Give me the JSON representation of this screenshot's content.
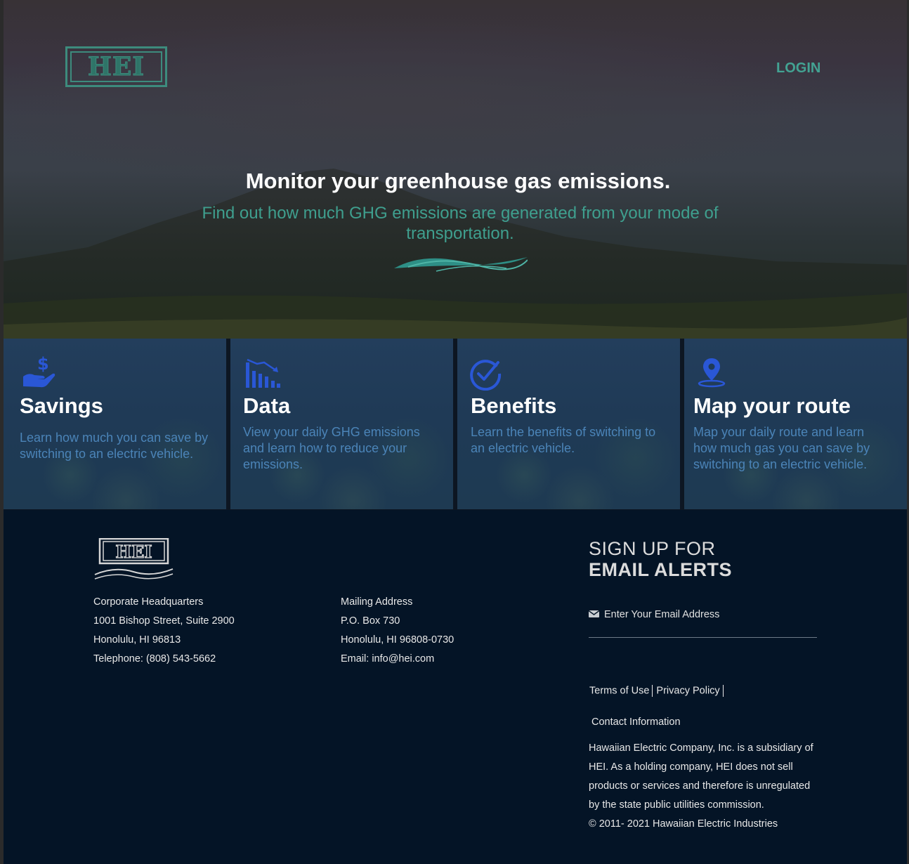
{
  "header": {
    "logo_text": "HEI",
    "login_label": "LOGIN"
  },
  "hero": {
    "title": "Monitor your greenhouse gas emissions.",
    "subtitle": "Find out how much GHG emissions are generated from your mode of transportation."
  },
  "cards": [
    {
      "icon": "dollar-hand-icon",
      "title": "Savings",
      "description": "Learn how much you can save by switching to an electric vehicle."
    },
    {
      "icon": "bar-chart-down-icon",
      "title": "Data",
      "description": "View your daily GHG emissions and learn how to reduce your emissions."
    },
    {
      "icon": "check-circle-icon",
      "title": "Benefits",
      "description": "Learn the benefits of switching to an electric vehicle."
    },
    {
      "icon": "map-pin-icon",
      "title": "Map your route",
      "description": "Map your daily route and learn how much gas you can save by switching to an electric vehicle."
    }
  ],
  "footer": {
    "logo_text": "HEI",
    "headquarters": {
      "heading": "Corporate Headquarters",
      "line1": "1001 Bishop Street, Suite 2900",
      "line2": "Honolulu, HI 96813",
      "phone": "Telephone: (808) 543-5662"
    },
    "mailing": {
      "heading": "Mailing Address",
      "line1": "P.O. Box 730",
      "line2": "Honolulu, HI 96808-0730",
      "email": "Email: info@hei.com"
    },
    "signup": {
      "line1": "SIGN UP FOR",
      "line2": "EMAIL ALERTS",
      "placeholder": "Enter Your Email Address"
    },
    "links": {
      "terms": "Terms of Use",
      "privacy": "Privacy Policy",
      "contact": "Contact Information"
    },
    "about": "Hawaiian Electric Company, Inc. is a subsidiary of HEI. As a holding company, HEI does not sell products or services and therefore is unregulated by the state public utilities commission.",
    "copyright": "© 2011- 2021 Hawaiian Electric Industries"
  },
  "colors": {
    "accent_teal": "#43a393",
    "card_text_blue": "#4b84b8",
    "icon_blue": "#2a57d6",
    "footer_bg": "#041426"
  }
}
